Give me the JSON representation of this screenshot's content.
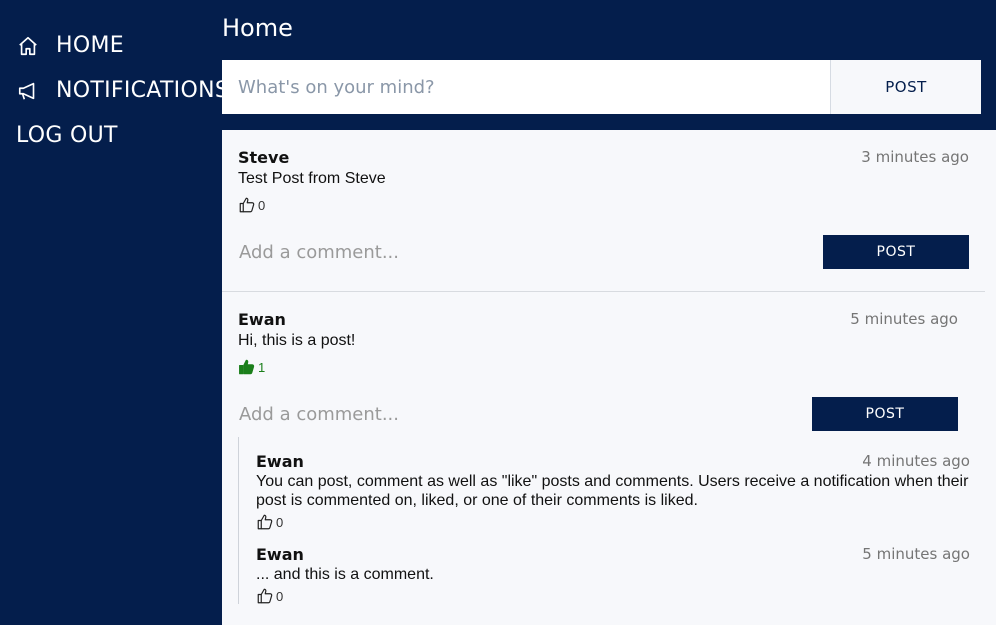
{
  "sidebar": {
    "items": [
      {
        "label": "HOME",
        "icon": "home-icon"
      },
      {
        "label": "NOTIFICATIONS",
        "icon": "megaphone-icon"
      },
      {
        "label": "LOG OUT"
      }
    ]
  },
  "header": {
    "title": "Home",
    "compose_placeholder": "What's on your mind?",
    "compose_button": "POST"
  },
  "posts": [
    {
      "author": "Steve",
      "time": "3 minutes ago",
      "text": "Test Post from Steve",
      "likes": "0",
      "liked": false,
      "comment_placeholder": "Add a comment...",
      "comment_button": "POST"
    },
    {
      "author": "Ewan",
      "time": "5 minutes ago",
      "text": "Hi, this is a post!",
      "likes": "1",
      "liked": true,
      "comment_placeholder": "Add a comment...",
      "comment_button": "POST",
      "comments": [
        {
          "author": "Ewan",
          "time": "4 minutes ago",
          "text": "You can post, comment as well as \"like\" posts and comments. Users receive a notification when their post is commented on, liked, or one of their comments is liked.",
          "likes": "0"
        },
        {
          "author": "Ewan",
          "time": "5 minutes ago",
          "text": "... and this is a comment.",
          "likes": "0"
        }
      ]
    }
  ],
  "colors": {
    "navy": "#041e4c",
    "feed_bg": "#f7f8fb",
    "liked_green": "#1b7f1b"
  }
}
